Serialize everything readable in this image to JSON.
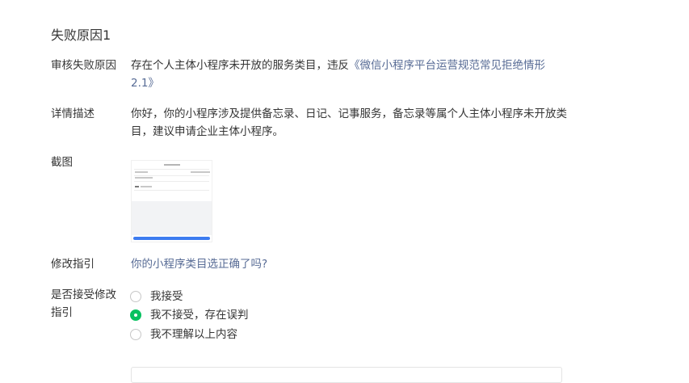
{
  "section": {
    "title": "失败原因1"
  },
  "rows": {
    "reason": {
      "label": "审核失败原因",
      "text": "存在个人主体小程序未开放的服务类目，违反",
      "link": "《微信小程序平台运营规范常见拒绝情形2.1》"
    },
    "detail": {
      "label": "详情描述",
      "text": "你好，你的小程序涉及提供备忘录、日记、记事服务，备忘录等属个人主体小程序未开放类目，建议申请企业主体小程序。"
    },
    "screenshot": {
      "label": "截图"
    },
    "guide": {
      "label": "修改指引",
      "link": "你的小程序类目选正确了吗?"
    },
    "accept": {
      "label": "是否接受修改指引",
      "options": [
        {
          "label": "我接受",
          "checked": false
        },
        {
          "label": "我不接受，存在误判",
          "checked": true
        },
        {
          "label": "我不理解以上内容",
          "checked": false
        }
      ]
    }
  },
  "colors": {
    "link": "#576b95",
    "radio_checked": "#07c160",
    "text": "#353535"
  }
}
